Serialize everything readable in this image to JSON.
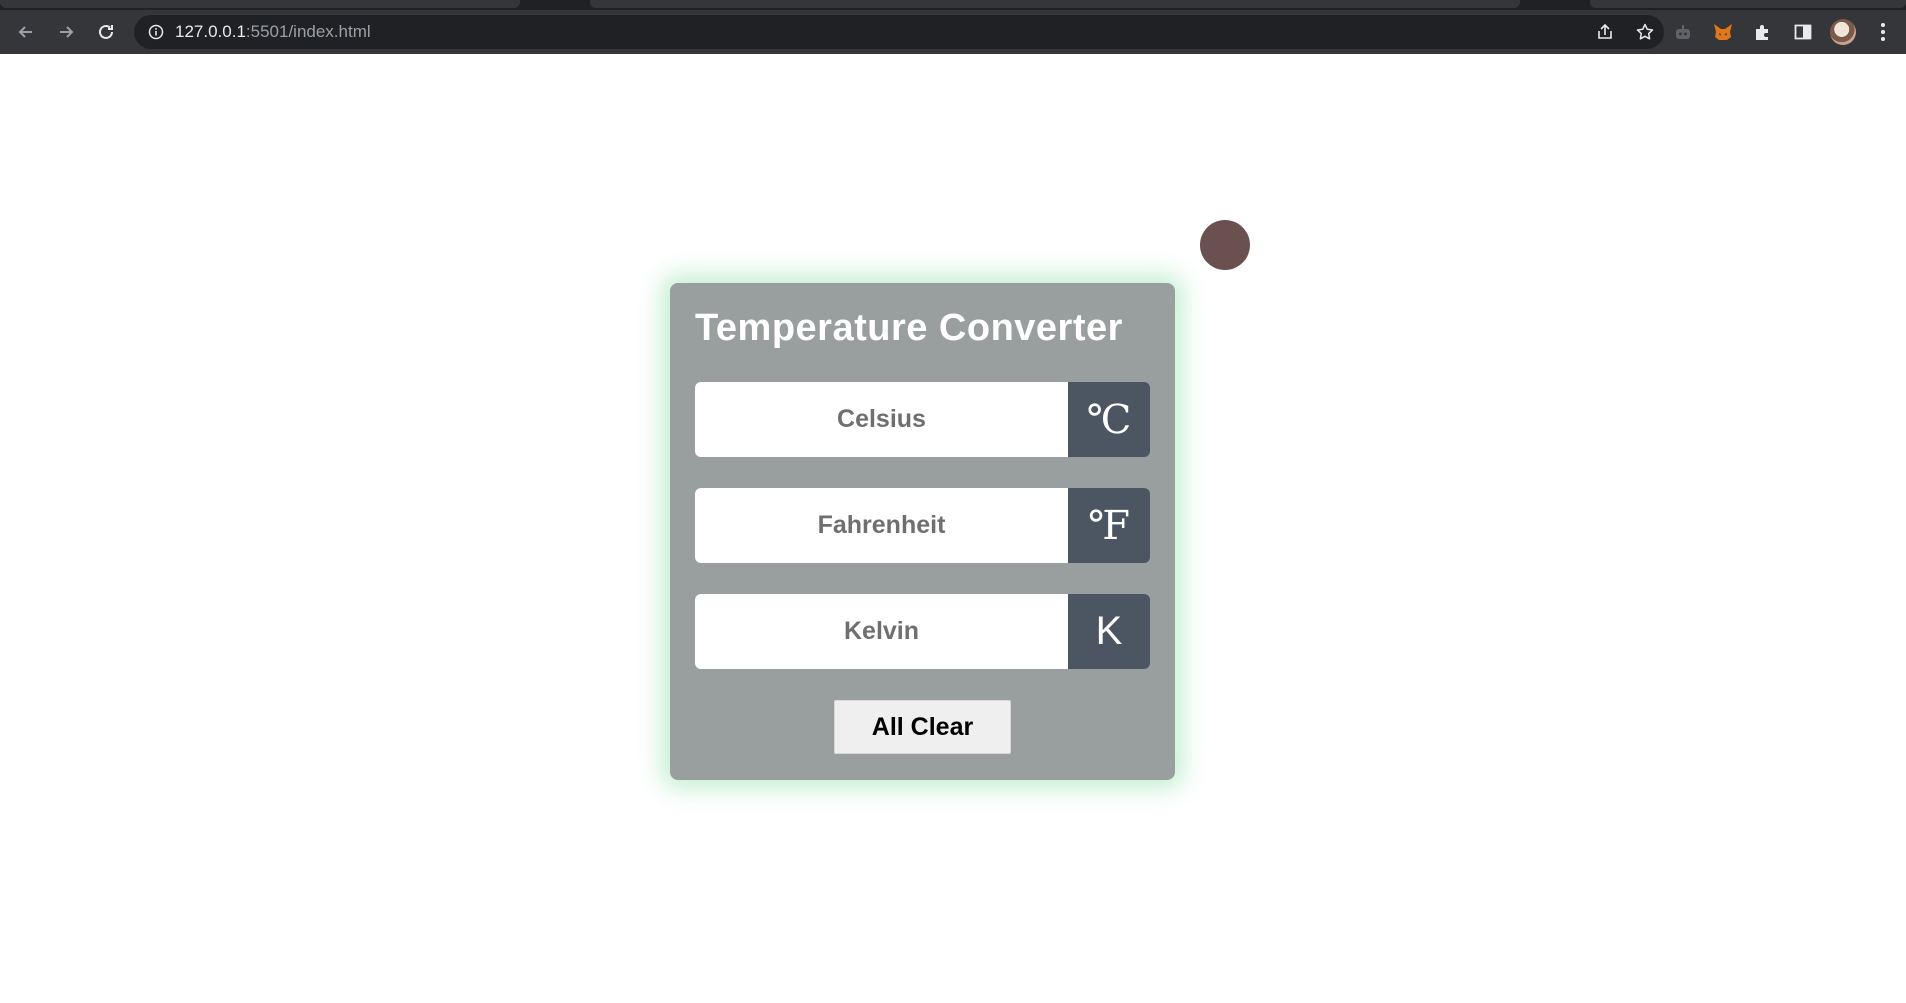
{
  "browser": {
    "url_host": "127.0.0.1",
    "url_path": ":5501/index.html",
    "icons": {
      "back": "arrow-left",
      "forward": "arrow-right",
      "reload": "reload",
      "site_info": "info-circle",
      "share": "share",
      "bookmark": "star",
      "extension_robot": "robot",
      "extension_metamask": "fox",
      "extensions": "puzzle-piece",
      "side_panel": "side-panel",
      "profile": "avatar",
      "menu": "vertical-dots"
    }
  },
  "converter": {
    "title": "Temperature Converter",
    "celsius": {
      "placeholder": "Celsius",
      "value": "",
      "unit": "℃"
    },
    "fahrenheit": {
      "placeholder": "Fahrenheit",
      "value": "",
      "unit": "℉"
    },
    "kelvin": {
      "placeholder": "Kelvin",
      "value": "",
      "unit": "K"
    },
    "clear_label": "All Clear"
  },
  "colors": {
    "card_bg": "#999e9e",
    "unit_bg": "#4b5662",
    "card_glow": "#78dc96",
    "dot": "#6b5050"
  }
}
